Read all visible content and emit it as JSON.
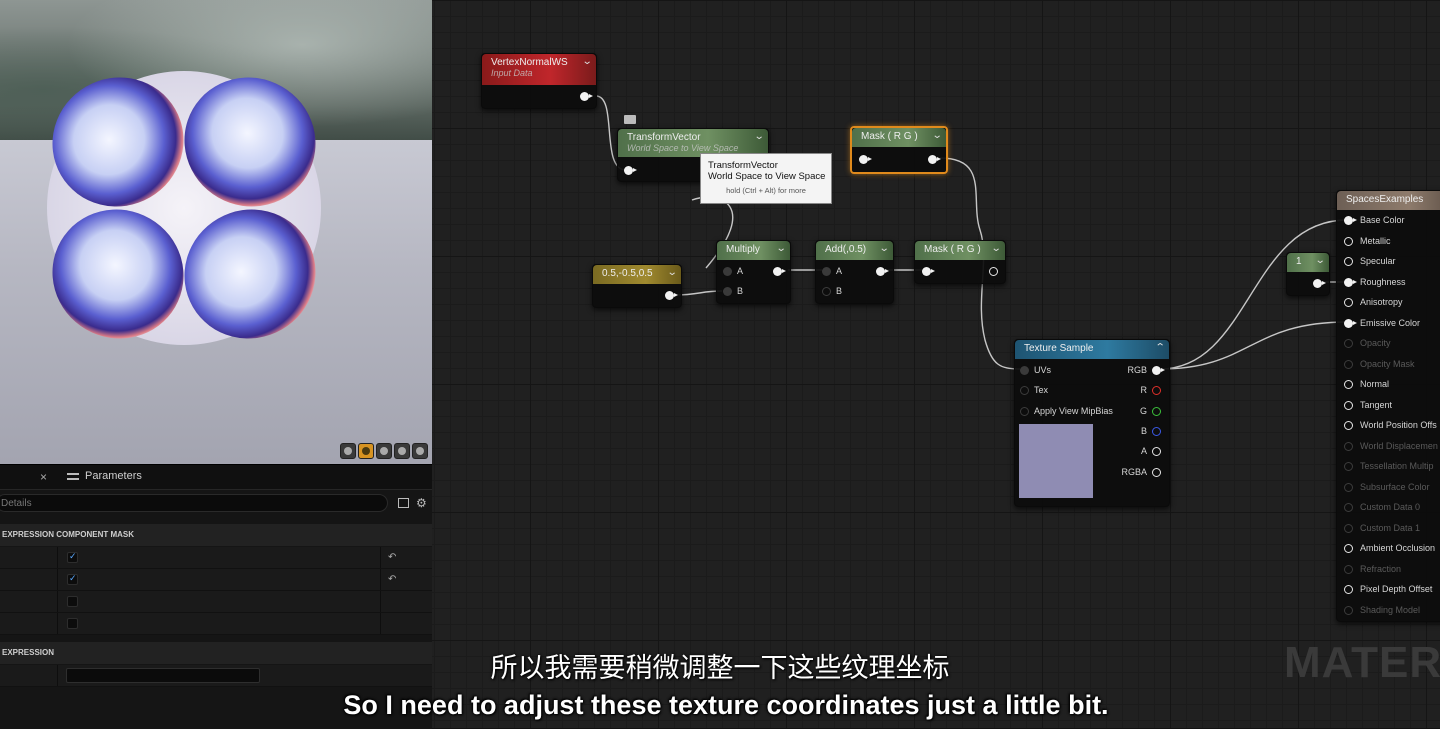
{
  "details": {
    "tab_close": "×",
    "tab_label": "Parameters",
    "search_placeholder": "Details",
    "section_mask": "EXPRESSION COMPONENT MASK",
    "mask_checks": [
      true,
      true,
      false,
      false
    ],
    "section_expression": "EXPRESSION"
  },
  "nodes": {
    "vertex": {
      "title": "VertexNormalWS",
      "subtitle": "Input Data"
    },
    "transform": {
      "title": "TransformVector",
      "subtitle": "World Space to View Space"
    },
    "mask1": {
      "title": "Mask ( R G )"
    },
    "constant": {
      "title": "0.5,-0.5,0.5"
    },
    "multiply": {
      "title": "Multiply",
      "pin_a": "A",
      "pin_b": "B"
    },
    "add": {
      "title": "Add(,0.5)",
      "pin_a": "A",
      "pin_b": "B"
    },
    "mask2": {
      "title": "Mask ( R G )"
    },
    "const1": {
      "title": "1"
    },
    "texture": {
      "title": "Texture Sample",
      "inputs": [
        "UVs",
        "Tex",
        "Apply View MipBias"
      ],
      "outputs": [
        "RGB",
        "R",
        "G",
        "B",
        "A",
        "RGBA"
      ]
    },
    "result": {
      "title": "SpacesExamples",
      "pins": [
        {
          "label": "Base Color",
          "active": true,
          "connected": true
        },
        {
          "label": "Metallic",
          "active": true,
          "connected": false
        },
        {
          "label": "Specular",
          "active": true,
          "connected": false
        },
        {
          "label": "Roughness",
          "active": true,
          "connected": true
        },
        {
          "label": "Anisotropy",
          "active": true,
          "connected": false
        },
        {
          "label": "Emissive Color",
          "active": true,
          "connected": true
        },
        {
          "label": "Opacity",
          "active": false,
          "connected": false
        },
        {
          "label": "Opacity Mask",
          "active": false,
          "connected": false
        },
        {
          "label": "Normal",
          "active": true,
          "connected": false
        },
        {
          "label": "Tangent",
          "active": true,
          "connected": false
        },
        {
          "label": "World Position Offs",
          "active": true,
          "connected": false
        },
        {
          "label": "World Displacemen",
          "active": false,
          "connected": false
        },
        {
          "label": "Tessellation Multip",
          "active": false,
          "connected": false
        },
        {
          "label": "Subsurface Color",
          "active": false,
          "connected": false
        },
        {
          "label": "Custom Data 0",
          "active": false,
          "connected": false
        },
        {
          "label": "Custom Data 1",
          "active": false,
          "connected": false
        },
        {
          "label": "Ambient Occlusion",
          "active": true,
          "connected": false
        },
        {
          "label": "Refraction",
          "active": false,
          "connected": false
        },
        {
          "label": "Pixel Depth Offset",
          "active": true,
          "connected": false
        },
        {
          "label": "Shading Model",
          "active": false,
          "connected": false
        }
      ]
    }
  },
  "tooltip": {
    "line1": "TransformVector",
    "line2": "World Space to View Space",
    "hint": "hold (Ctrl + Alt) for more"
  },
  "watermark": "MATERIA",
  "subtitles": {
    "cn": "所以我需要稍微调整一下这些纹理坐标",
    "en": "So I need to adjust these texture coordinates just a little bit."
  }
}
